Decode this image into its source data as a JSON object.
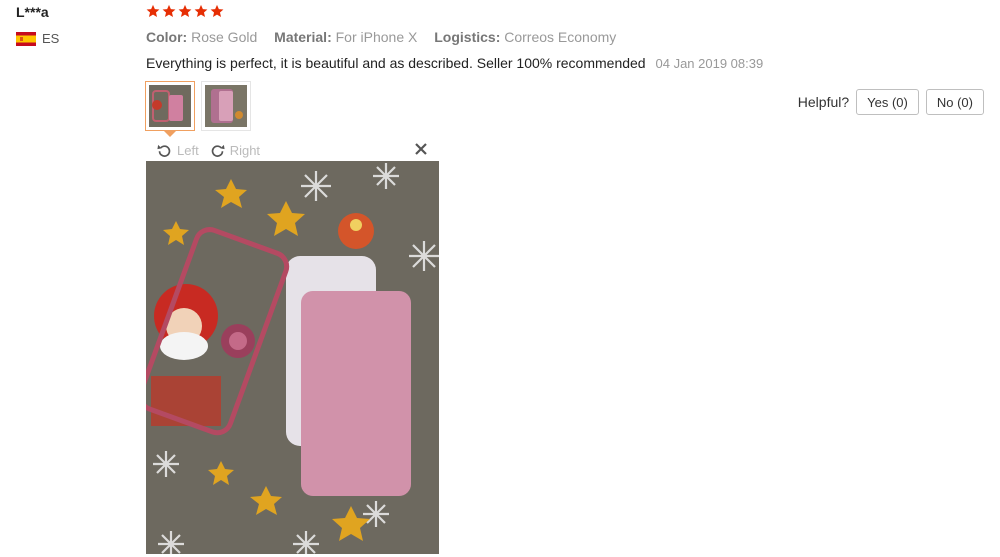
{
  "reviewer": {
    "name": "L***a",
    "country_code": "ES"
  },
  "rating": {
    "stars": 5,
    "max": 5,
    "star_color": "#e62e04"
  },
  "attributes": [
    {
      "key": "Color:",
      "value": "Rose Gold"
    },
    {
      "key": "Material:",
      "value": "For iPhone X"
    },
    {
      "key": "Logistics:",
      "value": "Correos Economy"
    }
  ],
  "review": {
    "text": "Everything is perfect, it is beautiful and as described. Seller 100% recommended",
    "date": "04 Jan 2019 08:39"
  },
  "helpful": {
    "label": "Helpful?",
    "yes_label": "Yes (0)",
    "no_label": "No (0)"
  },
  "viewer": {
    "rotate_left": "Left",
    "rotate_right": "Right",
    "close_icon": "close-icon"
  },
  "colors": {
    "accent": "#f0a060",
    "muted": "#999999"
  }
}
